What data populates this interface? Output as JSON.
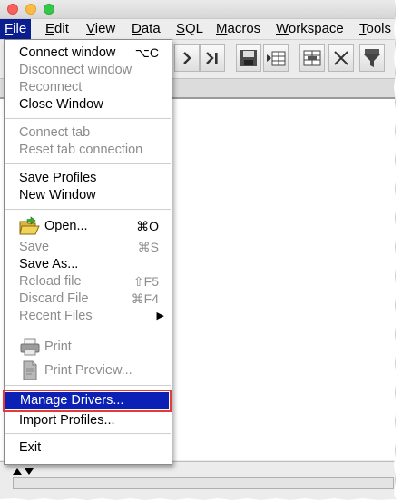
{
  "menubar": {
    "items": [
      "File",
      "Edit",
      "View",
      "Data",
      "SQL",
      "Macros",
      "Workspace",
      "Tools"
    ],
    "mnemonics": [
      "F",
      "E",
      "V",
      "D",
      "S",
      "M",
      "W",
      "T"
    ],
    "active_index": 0
  },
  "file_menu": {
    "connect_window": {
      "label": "Connect window",
      "shortcut": "⌥C"
    },
    "disconnect_window": {
      "label": "Disconnect window"
    },
    "reconnect": {
      "label": "Reconnect"
    },
    "close_window": {
      "label": "Close Window"
    },
    "connect_tab": {
      "label": "Connect tab"
    },
    "reset_tab_connection": {
      "label": "Reset tab connection"
    },
    "save_profiles": {
      "label": "Save Profiles"
    },
    "new_window": {
      "label": "New Window"
    },
    "open": {
      "label": "Open...",
      "shortcut": "⌘O"
    },
    "save": {
      "label": "Save",
      "shortcut": "⌘S"
    },
    "save_as": {
      "label": "Save As..."
    },
    "reload_file": {
      "label": "Reload file",
      "shortcut": "⇧F5"
    },
    "discard_file": {
      "label": "Discard File",
      "shortcut": "⌘F4"
    },
    "recent_files": {
      "label": "Recent Files",
      "arrow": "▶"
    },
    "print": {
      "label": "Print"
    },
    "print_preview": {
      "label": "Print Preview..."
    },
    "manage_drivers": {
      "label": "Manage Drivers..."
    },
    "import_profiles": {
      "label": "Import Profiles..."
    },
    "exit": {
      "label": "Exit"
    }
  },
  "colors": {
    "menu_highlight": "#0b20b5",
    "annotation_outline": "#e33a3a",
    "disabled_text": "#8c8c8c"
  }
}
